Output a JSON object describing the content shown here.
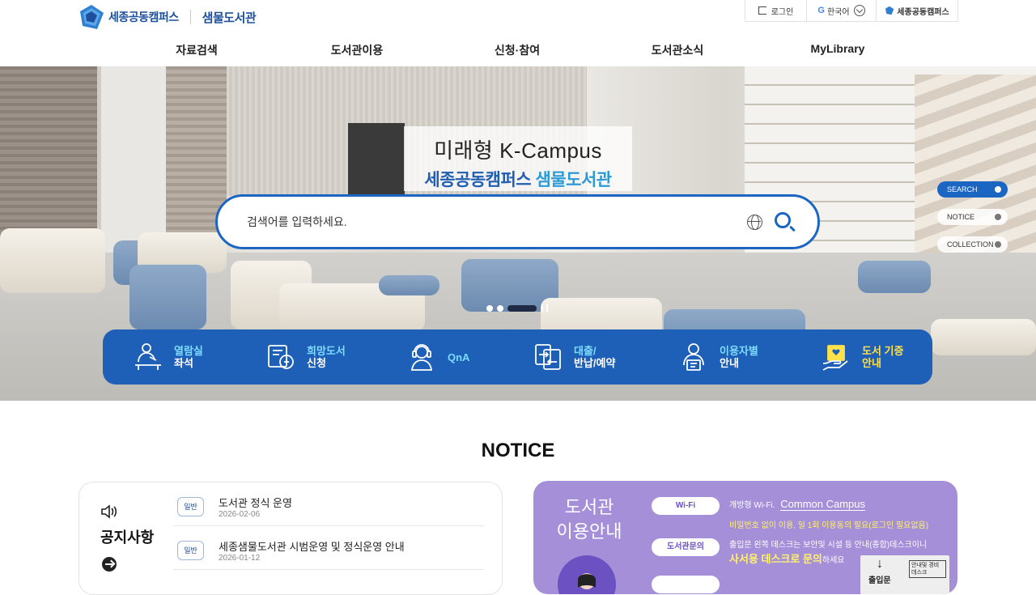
{
  "header": {
    "logo_text": "세종공동캠퍼스",
    "library_name": "샘물도서관",
    "utils": {
      "login": "로그인",
      "language": "한국어",
      "campus_link": "세종공동캠퍼스"
    }
  },
  "nav": {
    "items": [
      "자료검색",
      "도서관이용",
      "신청·참여",
      "도서관소식",
      "MyLibrary"
    ]
  },
  "hero": {
    "title_line1": "미래형 K-Campus",
    "title_line2_a": "세종공동캠퍼스",
    "title_line2_b": "샘물도서관",
    "search_placeholder": "검색어를 입력하세요.",
    "side_tabs": [
      "SEARCH",
      "NOTICE",
      "COLLECTION"
    ],
    "active_side_tab": "SEARCH",
    "slide_indicator": {
      "count": 3,
      "active": 3
    }
  },
  "quick_menu": [
    {
      "line1": "열람실",
      "line2": "좌석",
      "icon": "reading-room-icon"
    },
    {
      "line1": "희망도서",
      "line2": "신청",
      "icon": "book-request-icon"
    },
    {
      "line1": "QnA",
      "line2": "",
      "icon": "headset-icon"
    },
    {
      "line1": "대출/",
      "line2": "반납/예약",
      "icon": "loan-return-icon"
    },
    {
      "line1": "이용자별",
      "line2": "안내",
      "icon": "user-guide-icon"
    },
    {
      "line1": "도서 기증",
      "line2": "안내",
      "icon": "donation-icon"
    }
  ],
  "notice": {
    "section_title": "NOTICE",
    "board_title": "공지사항",
    "items": [
      {
        "badge": "일반",
        "title": "도서관 정식 운영",
        "date": "2026-02-06"
      },
      {
        "badge": "일반",
        "title": "세종샘물도서관 시범운영 및 정식운영 안내",
        "date": "2026-01-12"
      }
    ]
  },
  "guide": {
    "title_line1": "도서관",
    "title_line2": "이용안내",
    "wifi_label": "Wi-Fi",
    "wifi_text": "개방형 Wi-Fi.",
    "wifi_ssid": "Common Campus",
    "wifi_note": "비밀번호 없이 이용, 일 1회 이용동의 필요(로그인 필요없음)",
    "inquiry_label": "도서관문의",
    "inquiry_text": "출입문 왼쪽 데스크는 보안및 시설 등 안내(종합)데스크이니",
    "inquiry_highlight": "사서용 데스크로 문의",
    "inquiry_suffix": "하세요",
    "sign_entrance": "출입문",
    "sign_box": "안내및 경비데스크"
  },
  "colors": {
    "brand_blue": "#1d4f9c",
    "search_border": "#1b66c2",
    "quick_bg": "#1e5fb8",
    "guide_bg": "#a58fd9",
    "highlight_yellow": "#ffe14a"
  }
}
